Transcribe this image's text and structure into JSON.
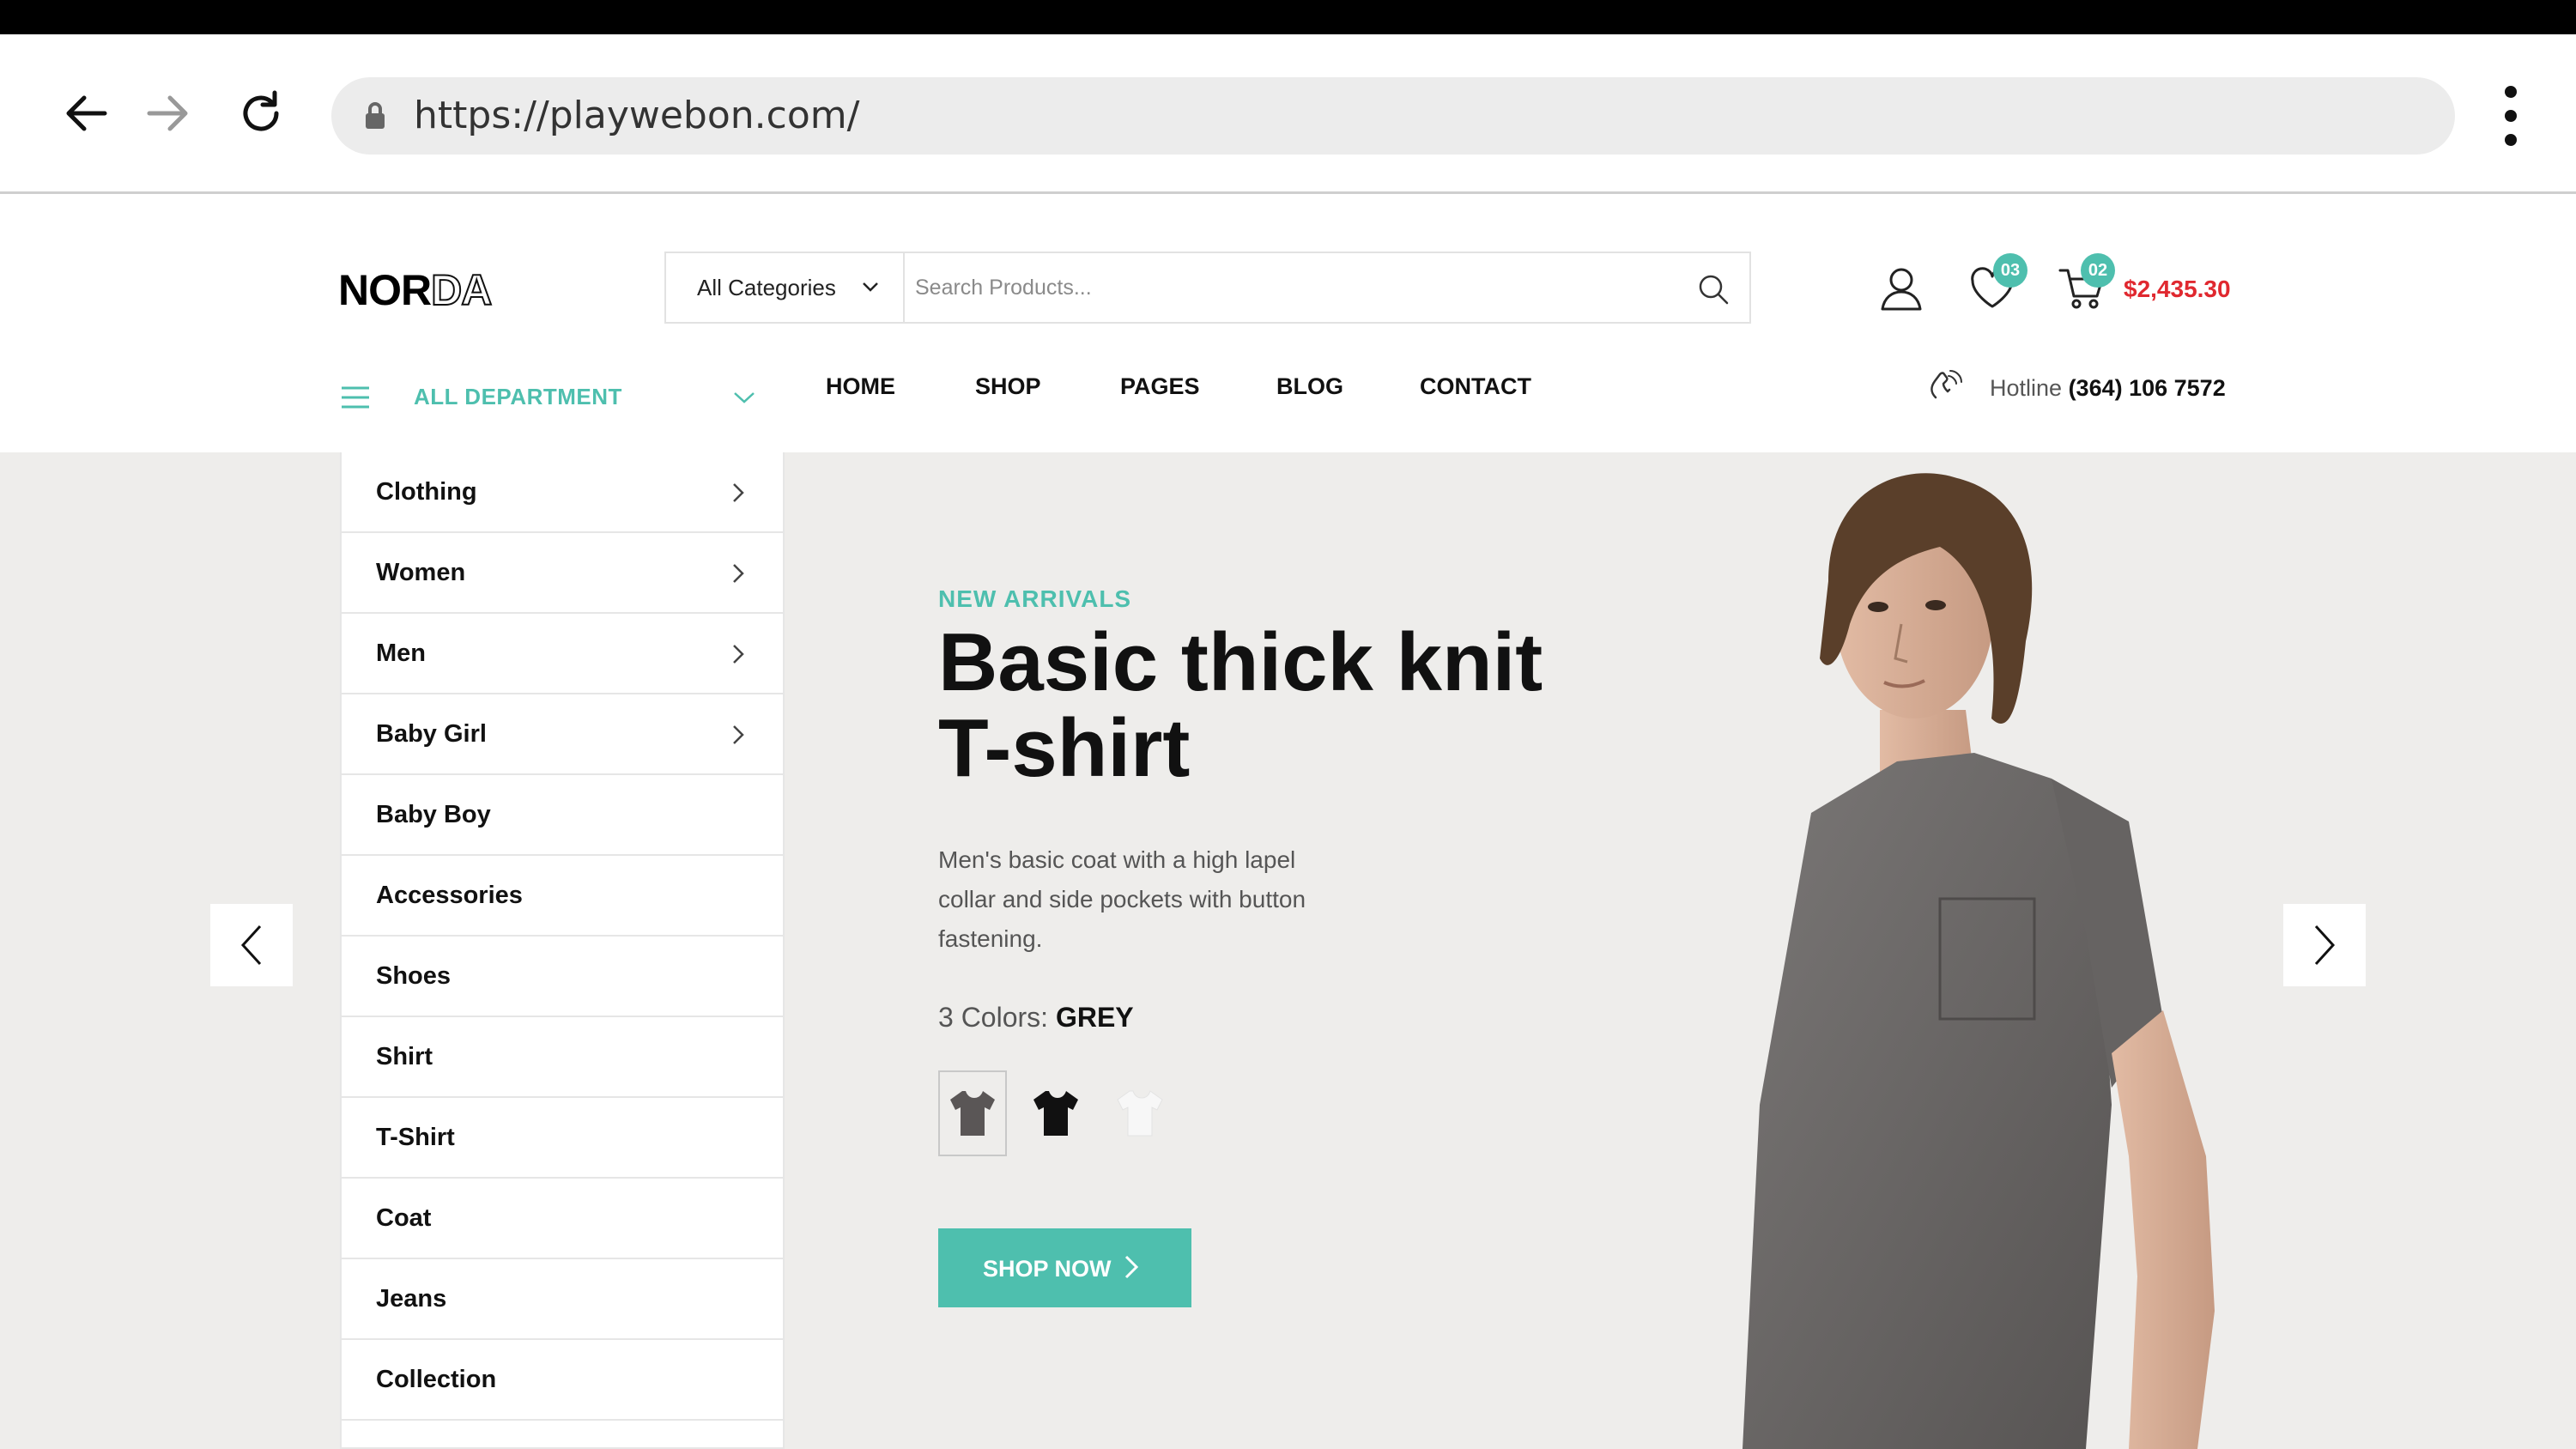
{
  "browser": {
    "url": "https://playwebon.com/",
    "icons": [
      "back-arrow-icon",
      "forward-arrow-icon",
      "reload-icon",
      "lock-icon",
      "more-vert-icon"
    ]
  },
  "site": {
    "logo": {
      "bold": "NOR",
      "outline": "DA"
    },
    "search": {
      "category_label": "All Categories",
      "placeholder": "Search Products..."
    },
    "wishlist_count": "03",
    "cart_count": "02",
    "cart_total": "$2,435.30",
    "all_department": "ALL DEPARTMENT",
    "nav": [
      "HOME",
      "SHOP",
      "PAGES",
      "BLOG",
      "CONTACT"
    ],
    "hotline_label": "Hotline",
    "hotline_number": "(364) 106 7572",
    "accent_color": "#4ebfae",
    "price_color": "#e0282f"
  },
  "categories": [
    {
      "label": "Clothing"
    },
    {
      "label": "Women"
    },
    {
      "label": "Men"
    },
    {
      "label": "Baby Girl"
    },
    {
      "label": "Baby Boy"
    },
    {
      "label": "Accessories"
    },
    {
      "label": "Shoes"
    },
    {
      "label": "Shirt"
    },
    {
      "label": "T-Shirt"
    },
    {
      "label": "Coat"
    },
    {
      "label": "Jeans"
    },
    {
      "label": "Collection"
    }
  ],
  "hero": {
    "subtitle": "NEW ARRIVALS",
    "title_line1": "Basic thick knit",
    "title_line2": "T-shirt",
    "description_lines": [
      "Men's basic coat with a high lapel",
      "collar and side pockets with button",
      "fastening."
    ],
    "colors_label": "3 Colors:",
    "selected_color": "GREY",
    "swatches": [
      {
        "name": "grey",
        "hex": "#5a5656"
      },
      {
        "name": "black",
        "hex": "#111111"
      },
      {
        "name": "white",
        "hex": "#f7f7f7"
      }
    ],
    "cta": "SHOP NOW"
  }
}
